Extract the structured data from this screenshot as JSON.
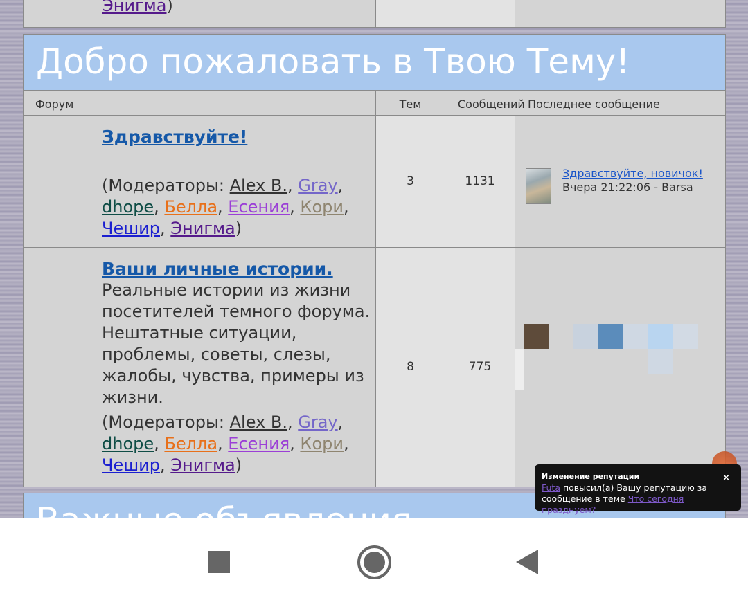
{
  "top_row": {
    "mods_tail_link": "Энигма",
    "mods_tail_suffix": ")"
  },
  "category": {
    "title": "Добро пожаловать в Твою Тему!"
  },
  "header": {
    "forum": "Форум",
    "topics": "Тем",
    "posts": "Сообщений",
    "last_post": "Последнее сообщение"
  },
  "forums": [
    {
      "title": "Здравствуйте!",
      "description": "",
      "topics": "3",
      "posts": "1131",
      "mods_prefix": "(Модераторы: ",
      "last_post": {
        "title": "Здравствуйте, новичок!",
        "meta": "Вчера 21:22:06 - Barsa"
      }
    },
    {
      "title": "Ваши личные истории.",
      "description": "Реальные истории из жизни посетителей темного форума. Нештатные ситуации, проблемы, советы, слезы, жалобы, чувства, примеры из жизни.",
      "topics": "8",
      "posts": "775",
      "mods_prefix": "(Модераторы: "
    }
  ],
  "moderators": [
    {
      "name": "Alex B.",
      "color": "#333333"
    },
    {
      "name": "Gray",
      "color": "#7466c9"
    },
    {
      "name": "dhope",
      "color": "#0f4d46"
    },
    {
      "name": "Белла",
      "color": "#e8701a"
    },
    {
      "name": "Есения",
      "color": "#9b3fd6"
    },
    {
      "name": "Кори",
      "color": "#8f8570"
    },
    {
      "name": "Чешир",
      "color": "#1b1fd0"
    },
    {
      "name": "Энигма",
      "color": "#551a8b"
    }
  ],
  "mods_suffix": ")",
  "category2": {
    "title": "Важные объявления"
  },
  "toast": {
    "title": "Изменение репутации",
    "close": "×",
    "user": "Futa",
    "text": " повысил(а) Вашу репутацию за сообщение в теме ",
    "topic": "Что сегодня празднуем?"
  },
  "colors": {
    "category_bg": "#a9c8ee",
    "row_bg": "#d4d4d4",
    "link": "#1558a8"
  },
  "icons": [
    "square-nav-icon",
    "home-circle-icon",
    "back-triangle-icon",
    "close-icon"
  ]
}
